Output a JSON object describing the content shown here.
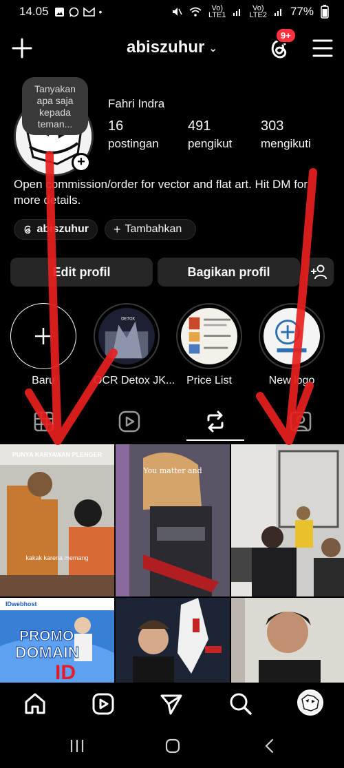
{
  "status_bar": {
    "time": "14.05",
    "battery": "77%",
    "sim1": "LTE1",
    "sim2": "LTE2",
    "network_label": "Vo)"
  },
  "header": {
    "username": "abiszuhur",
    "threads_badge": "9+"
  },
  "profile": {
    "note": "Tanyakan apa saja kepada teman...",
    "full_name": "Fahri Indra",
    "stats": [
      {
        "value": "16",
        "label": "postingan"
      },
      {
        "value": "491",
        "label": "pengikut"
      },
      {
        "value": "303",
        "label": "mengikuti"
      }
    ],
    "bio": "Open commission/order for vector and flat art. Hit DM for more details."
  },
  "chips": {
    "threads_handle": "abiszuhur",
    "add": "Tambahkan"
  },
  "buttons": {
    "edit": "Edit profil",
    "share": "Bagikan profil"
  },
  "highlights": [
    {
      "label": "Baru"
    },
    {
      "label": "OCR Detox JK..."
    },
    {
      "label": "Price List"
    },
    {
      "label": "New logo"
    }
  ],
  "grid": {
    "post1_caption_top": "PUNYA KARYAWAN PLENGER",
    "post1_caption_bottom": "kakak karena memang",
    "post2_caption": "You matter and",
    "post4_brand": "IDwebhost",
    "post4_promo1": "PROMO",
    "post4_promo2": "DOMAIN",
    "post4_promo3": "ID"
  },
  "colors": {
    "background": "#000000",
    "button_bg": "#262626",
    "badge": "#ff3040",
    "annotation": "#e8201f"
  }
}
